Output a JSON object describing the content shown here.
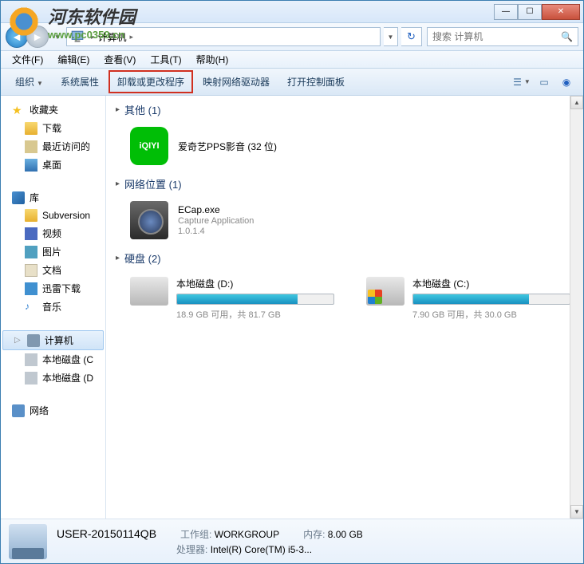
{
  "watermark": {
    "title": "河东软件园",
    "url": "www.pc0359.cn"
  },
  "menubar": {
    "file": "文件(F)",
    "edit": "编辑(E)",
    "view": "查看(V)",
    "tools": "工具(T)",
    "help": "帮助(H)"
  },
  "breadcrumb": {
    "location": "计算机"
  },
  "search": {
    "placeholder": "搜索 计算机"
  },
  "toolbar": {
    "organize": "组织",
    "properties": "系统属性",
    "uninstall": "卸载或更改程序",
    "mapdrive": "映射网络驱动器",
    "controlpanel": "打开控制面板"
  },
  "sidebar": {
    "favorites": {
      "label": "收藏夹",
      "items": [
        "下载",
        "最近访问的",
        "桌面"
      ]
    },
    "libraries": {
      "label": "库",
      "items": [
        "Subversion",
        "视频",
        "图片",
        "文档",
        "迅雷下载",
        "音乐"
      ]
    },
    "computer": {
      "label": "计算机",
      "items": [
        "本地磁盘 (C",
        "本地磁盘 (D"
      ]
    },
    "network": {
      "label": "网络"
    }
  },
  "sections": {
    "other": {
      "title": "其他 (1)",
      "items": [
        {
          "name": "爱奇艺PPS影音 (32 位)",
          "icon": "iQIYI"
        }
      ]
    },
    "netloc": {
      "title": "网络位置 (1)",
      "items": [
        {
          "name": "ECap.exe",
          "desc": "Capture Application",
          "ver": "1.0.1.4"
        }
      ]
    },
    "drives": {
      "title": "硬盘 (2)",
      "items": [
        {
          "name": "本地磁盘 (D:)",
          "free": "18.9 GB 可用，共 81.7 GB",
          "pct": 77
        },
        {
          "name": "本地磁盘 (C:)",
          "free": "7.90 GB 可用，共 30.0 GB",
          "pct": 74
        }
      ]
    }
  },
  "details": {
    "name": "USER-20150114QB",
    "workgroup_label": "工作组:",
    "workgroup": "WORKGROUP",
    "memory_label": "内存:",
    "memory": "8.00 GB",
    "cpu_label": "处理器:",
    "cpu": "Intel(R) Core(TM) i5-3..."
  }
}
